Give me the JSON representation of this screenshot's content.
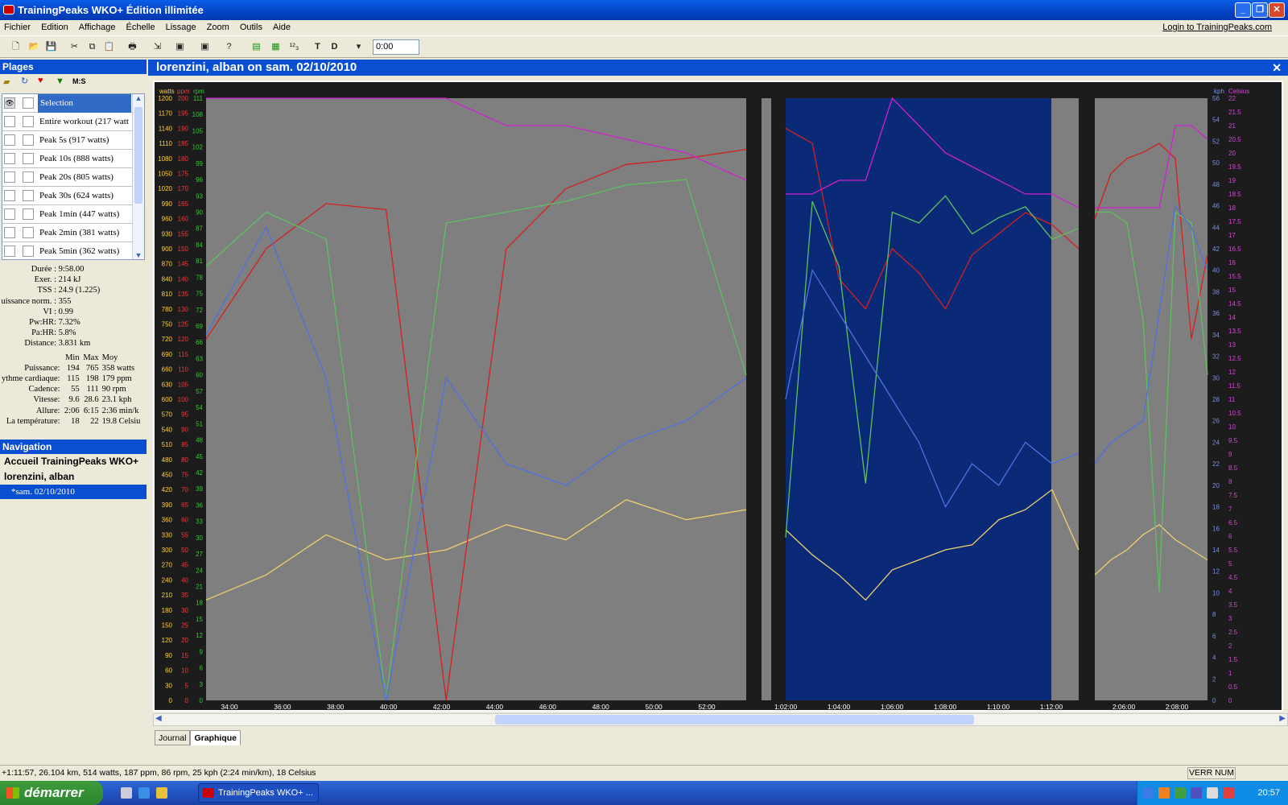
{
  "window": {
    "title": "TrainingPeaks WKO+ Édition illimitée"
  },
  "menu": {
    "items": [
      "Fichier",
      "Edition",
      "Affichage",
      "Échelle",
      "Lissage",
      "Zoom",
      "Outils",
      "Aide"
    ],
    "login": "Login to TrainingPeaks.com"
  },
  "toolbar": {
    "time_value": "0:00"
  },
  "plages": {
    "title": "Plages",
    "ms_label": "M:S",
    "items": [
      "Selection",
      "Entire workout (217 watt",
      "Peak 5s (917 watts)",
      "Peak 10s (888 watts)",
      "Peak 20s (805 watts)",
      "Peak 30s (624 watts)",
      "Peak 1min (447 watts)",
      "Peak 2min (381 watts)",
      "Peak 5min (362 watts)"
    ]
  },
  "stats": {
    "lines": [
      [
        "Durée :",
        "9:58.00"
      ],
      [
        "Exer. :",
        "214 kJ"
      ],
      [
        "TSS :",
        "24.9 (1.225)"
      ],
      [
        "uissance norm. :",
        "355"
      ],
      [
        "VI :",
        "0.99"
      ],
      [
        "Pw:HR:",
        "7.32%"
      ],
      [
        "Pa:HR:",
        "5.8%"
      ],
      [
        "Distance:",
        "3.831 km"
      ]
    ],
    "header": [
      "Min",
      "Max",
      "Moy"
    ],
    "rows": [
      [
        "Puissance:",
        "194",
        "765",
        "358 watts"
      ],
      [
        "ythme cardiaque:",
        "115",
        "198",
        "179 ppm"
      ],
      [
        "Cadence:",
        "55",
        "111",
        "90 rpm"
      ],
      [
        "Vitesse:",
        "9.6",
        "28.6",
        "23.1 kph"
      ],
      [
        "Allure:",
        "2:06",
        "6:15",
        "2:36 min/k"
      ],
      [
        "La température:",
        "18",
        "22",
        "19.8 Celsiu"
      ]
    ]
  },
  "navigation": {
    "title": "Navigation",
    "home": "Accueil TrainingPeaks WKO+",
    "athlete": "lorenzini, alban",
    "workout": "*sam. 02/10/2010"
  },
  "chart": {
    "title": "lorenzini, alban on sam. 02/10/2010"
  },
  "chart_data": {
    "type": "line",
    "units": {
      "left1": "watts",
      "left2": "ppm",
      "left3": "rpm",
      "right1": "kph",
      "right2": "Celsius"
    },
    "power_ticks": [
      0,
      30,
      60,
      90,
      120,
      150,
      180,
      210,
      240,
      270,
      300,
      330,
      360,
      390,
      420,
      450,
      480,
      510,
      540,
      570,
      600,
      630,
      660,
      690,
      720,
      750,
      780,
      810,
      840,
      870,
      900,
      930,
      960,
      990,
      1020,
      1050,
      1080,
      1110,
      1140,
      1170,
      1200
    ],
    "hr_ticks": [
      0,
      5,
      10,
      15,
      20,
      25,
      30,
      35,
      40,
      45,
      50,
      55,
      60,
      65,
      70,
      75,
      80,
      85,
      90,
      95,
      100,
      105,
      110,
      115,
      120,
      125,
      130,
      135,
      140,
      145,
      150,
      155,
      160,
      165,
      170,
      175,
      180,
      185,
      190,
      195,
      200
    ],
    "cad_ticks": [
      0,
      3,
      6,
      9,
      12,
      15,
      18,
      21,
      24,
      27,
      30,
      33,
      36,
      39,
      42,
      45,
      48,
      51,
      54,
      57,
      60,
      63,
      66,
      69,
      72,
      75,
      78,
      81,
      84,
      87,
      90,
      93,
      96,
      99,
      102,
      105,
      108,
      111
    ],
    "speed_ticks": [
      0,
      2,
      4,
      6,
      8,
      10,
      12,
      14,
      16,
      18,
      20,
      22,
      24,
      26,
      28,
      30,
      32,
      34,
      36,
      38,
      40,
      42,
      44,
      46,
      48,
      50,
      52,
      54,
      56
    ],
    "temp_ticks": [
      0,
      0.5,
      1,
      1.5,
      2,
      2.5,
      3,
      3.5,
      4,
      4.5,
      5,
      5.5,
      6,
      6.5,
      7,
      7.5,
      8,
      8.5,
      9,
      9.5,
      10,
      10.5,
      11,
      11.5,
      12,
      12.5,
      13,
      13.5,
      14,
      14.5,
      15,
      15.5,
      16,
      16.5,
      17,
      17.5,
      18,
      18.5,
      19,
      19.5,
      20,
      20.5,
      21,
      21.5,
      22
    ],
    "x_ticks_1": [
      "34:00",
      "36:00",
      "38:00",
      "40:00",
      "42:00",
      "44:00",
      "46:00",
      "48:00",
      "50:00",
      "52:00"
    ],
    "x_ticks_2": [
      "1:02:00",
      "1:04:00",
      "1:06:00",
      "1:08:00",
      "1:10:00",
      "1:12:00"
    ],
    "x_ticks_3": [
      "2:06:00",
      "2:08:00"
    ],
    "series": [
      {
        "name": "watts",
        "color": "#f0d070",
        "values": [
          200,
          250,
          330,
          280,
          300,
          350,
          320,
          400,
          360,
          380,
          340,
          290,
          250,
          200,
          260,
          280,
          300,
          310,
          360,
          380,
          420,
          300,
          250,
          280,
          300,
          330,
          350,
          320,
          300,
          280
        ]
      },
      {
        "name": "ppm",
        "color": "#d42020",
        "values": [
          120,
          150,
          165,
          163,
          0,
          150,
          170,
          178,
          180,
          183,
          190,
          185,
          140,
          130,
          150,
          142,
          130,
          148,
          155,
          162,
          158,
          150,
          160,
          175,
          180,
          182,
          185,
          180,
          120,
          148
        ]
      },
      {
        "name": "rpm",
        "color": "#60c060",
        "values": [
          80,
          90,
          85,
          0,
          88,
          90,
          92,
          95,
          96,
          60,
          30,
          92,
          80,
          40,
          90,
          88,
          93,
          86,
          89,
          91,
          85,
          87,
          90,
          90,
          88,
          70,
          20,
          90,
          88,
          60
        ]
      },
      {
        "name": "kph",
        "color": "#5070e0",
        "values": [
          34,
          44,
          30,
          0,
          30,
          22,
          20,
          24,
          26,
          30,
          28,
          40,
          36,
          32,
          28,
          24,
          18,
          22,
          20,
          24,
          22,
          23,
          22,
          24,
          25,
          26,
          36,
          46,
          44,
          40
        ]
      },
      {
        "name": "Celsius",
        "color": "#d020d0",
        "values": [
          22,
          22,
          22,
          22,
          22,
          21,
          21,
          20.5,
          20,
          19,
          18.5,
          18.5,
          19,
          19,
          22,
          21,
          20,
          19.5,
          19,
          18.5,
          18.5,
          18,
          18,
          18,
          18,
          18,
          18,
          21,
          21,
          20.5
        ]
      }
    ]
  },
  "tabs": [
    "Journal",
    "Graphique"
  ],
  "status": {
    "text": "+1:11:57, 26.104 km, 514 watts, 187 ppm, 86 rpm, 25 kph (2:24 min/km), 18 Celsius",
    "verr": "VERR NUM"
  },
  "taskbar": {
    "start": "démarrer",
    "app": "TrainingPeaks WKO+ ...",
    "clock": "20:57"
  }
}
